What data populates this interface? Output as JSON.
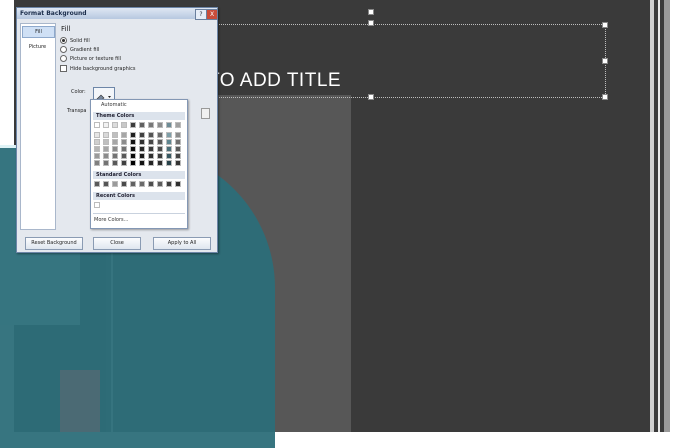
{
  "slide": {
    "title_placeholder": "TO ADD TITLE"
  },
  "dialog": {
    "title": "Format Background",
    "help_glyph": "?",
    "close_glyph": "X",
    "nav": [
      {
        "label": "Fill"
      },
      {
        "label": "Picture"
      }
    ],
    "section_heading": "Fill",
    "radios": [
      {
        "label": "Solid fill",
        "selected": true
      },
      {
        "label": "Gradient fill",
        "selected": false
      },
      {
        "label": "Picture or texture fill",
        "selected": false
      }
    ],
    "hide_graphics_label": "Hide background graphics",
    "color_label": "Color:",
    "transparency_label": "Transpa",
    "buttons": {
      "reset": "Reset Background",
      "close": "Close",
      "apply": "Apply to All"
    }
  },
  "color_menu": {
    "automatic": "Automatic",
    "theme_header": "Theme Colors",
    "standard_header": "Standard Colors",
    "recent_header": "Recent Colors",
    "more": "More Colors...",
    "theme_row1": [
      "#ffffff",
      "#f2f2f2",
      "#dcdcdc",
      "#c8c8c8",
      "#3c3c3c",
      "#606060",
      "#787878",
      "#8c8c8c",
      "#6e8c96",
      "#a0a0a0"
    ],
    "theme_shades": [
      [
        "#e6e6e6",
        "#d9d9d9",
        "#bfbfbf",
        "#a6a6a6",
        "#1f1f1f",
        "#3f3f3f",
        "#545454",
        "#6a6a6a",
        "#7f9fa8",
        "#8c8c8c"
      ],
      [
        "#cfcfcf",
        "#bfbfbf",
        "#a6a6a6",
        "#8c8c8c",
        "#141414",
        "#303030",
        "#474747",
        "#5a5a5a",
        "#5f8690",
        "#707070"
      ],
      [
        "#b5b5b5",
        "#a6a6a6",
        "#8c8c8c",
        "#737373",
        "#0d0d0d",
        "#262626",
        "#3a3a3a",
        "#4a4a4a",
        "#4a6f79",
        "#5a5a5a"
      ],
      [
        "#9a9a9a",
        "#8c8c8c",
        "#737373",
        "#595959",
        "#080808",
        "#1a1a1a",
        "#2e2e2e",
        "#3a3a3a",
        "#375861",
        "#454545"
      ],
      [
        "#7f7f7f",
        "#737373",
        "#595959",
        "#404040",
        "#000000",
        "#111111",
        "#222222",
        "#2b2b2b",
        "#27424a",
        "#333333"
      ]
    ],
    "standard": [
      "#5a5a5a",
      "#555555",
      "#9a9a9a",
      "#4a4a4a",
      "#626262",
      "#6a6a6a",
      "#4e4e4e",
      "#5c5c5c",
      "#3e3e3e",
      "#2f2f2f"
    ],
    "recent": [
      "#ffffff"
    ]
  }
}
